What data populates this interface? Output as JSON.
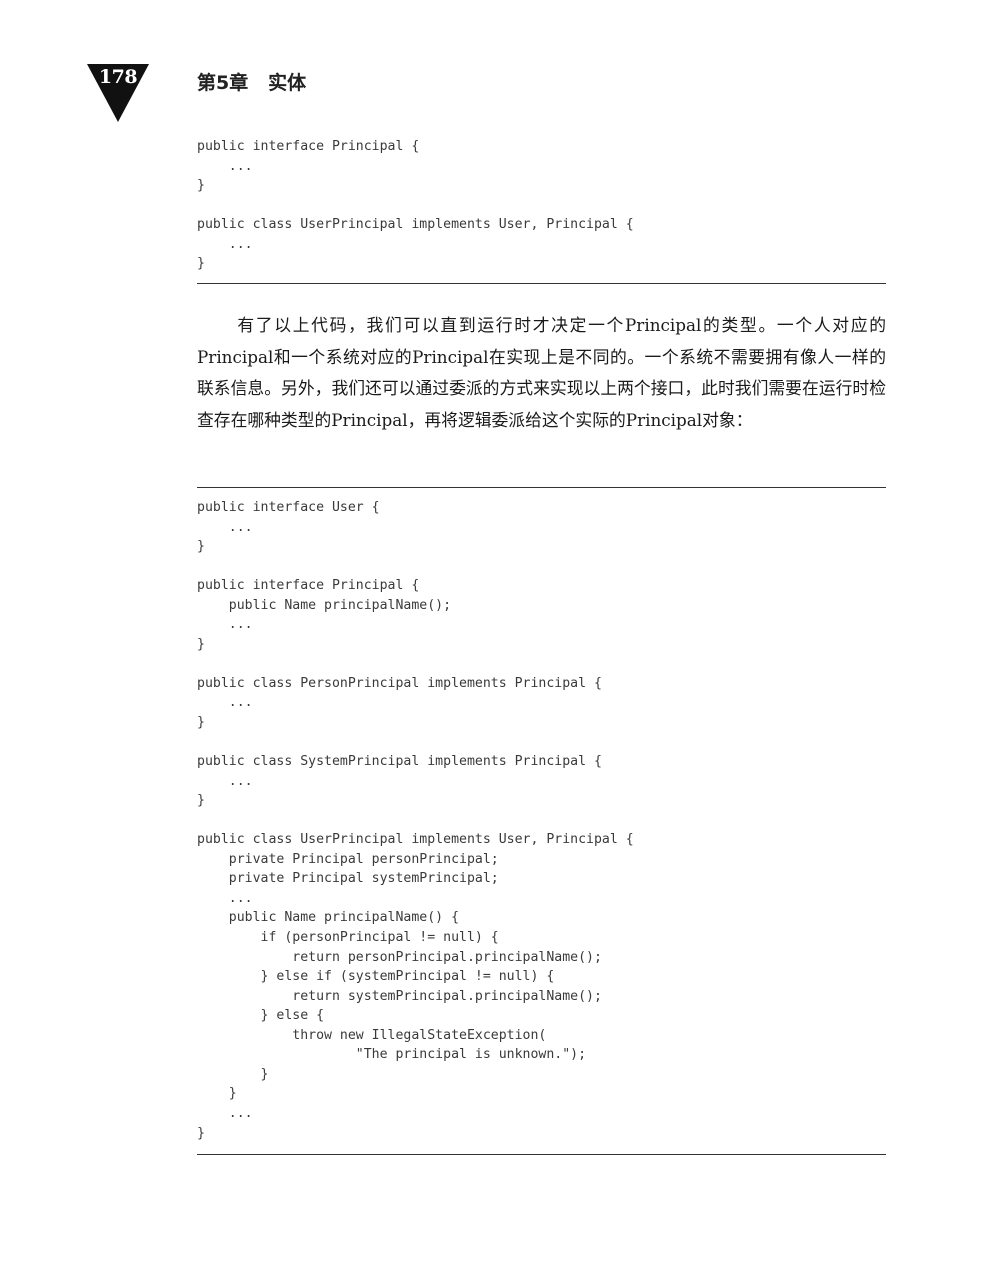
{
  "header": {
    "page_number": "178",
    "chapter_title": "第5章   实体"
  },
  "code_blocks": [
    "public interface Principal {\n    ...\n}\n\npublic class UserPrincipal implements User, Principal {\n    ...\n}",
    "public interface User {\n    ...\n}\n\npublic interface Principal {\n    public Name principalName();\n    ...\n}\n\npublic class PersonPrincipal implements Principal {\n    ...\n}\n\npublic class SystemPrincipal implements Principal {\n    ...\n}\n\npublic class UserPrincipal implements User, Principal {\n    private Principal personPrincipal;\n    private Principal systemPrincipal;\n    ...\n    public Name principalName() {\n        if (personPrincipal != null) {\n            return personPrincipal.principalName();\n        } else if (systemPrincipal != null) {\n            return systemPrincipal.principalName();\n        } else {\n            throw new IllegalStateException(\n                    \"The principal is unknown.\");\n        }\n    }\n    ...\n}"
  ],
  "body": {
    "paragraph": "有了以上代码，我们可以直到运行时才决定一个Principal的类型。一个人对应的Principal和一个系统对应的Principal在实现上是不同的。一个系统不需要拥有像人一样的联系信息。另外，我们还可以通过委派的方式来实现以上两个接口，此时我们需要在运行时检查存在哪种类型的Principal，再将逻辑委派给这个实际的Principal对象："
  }
}
